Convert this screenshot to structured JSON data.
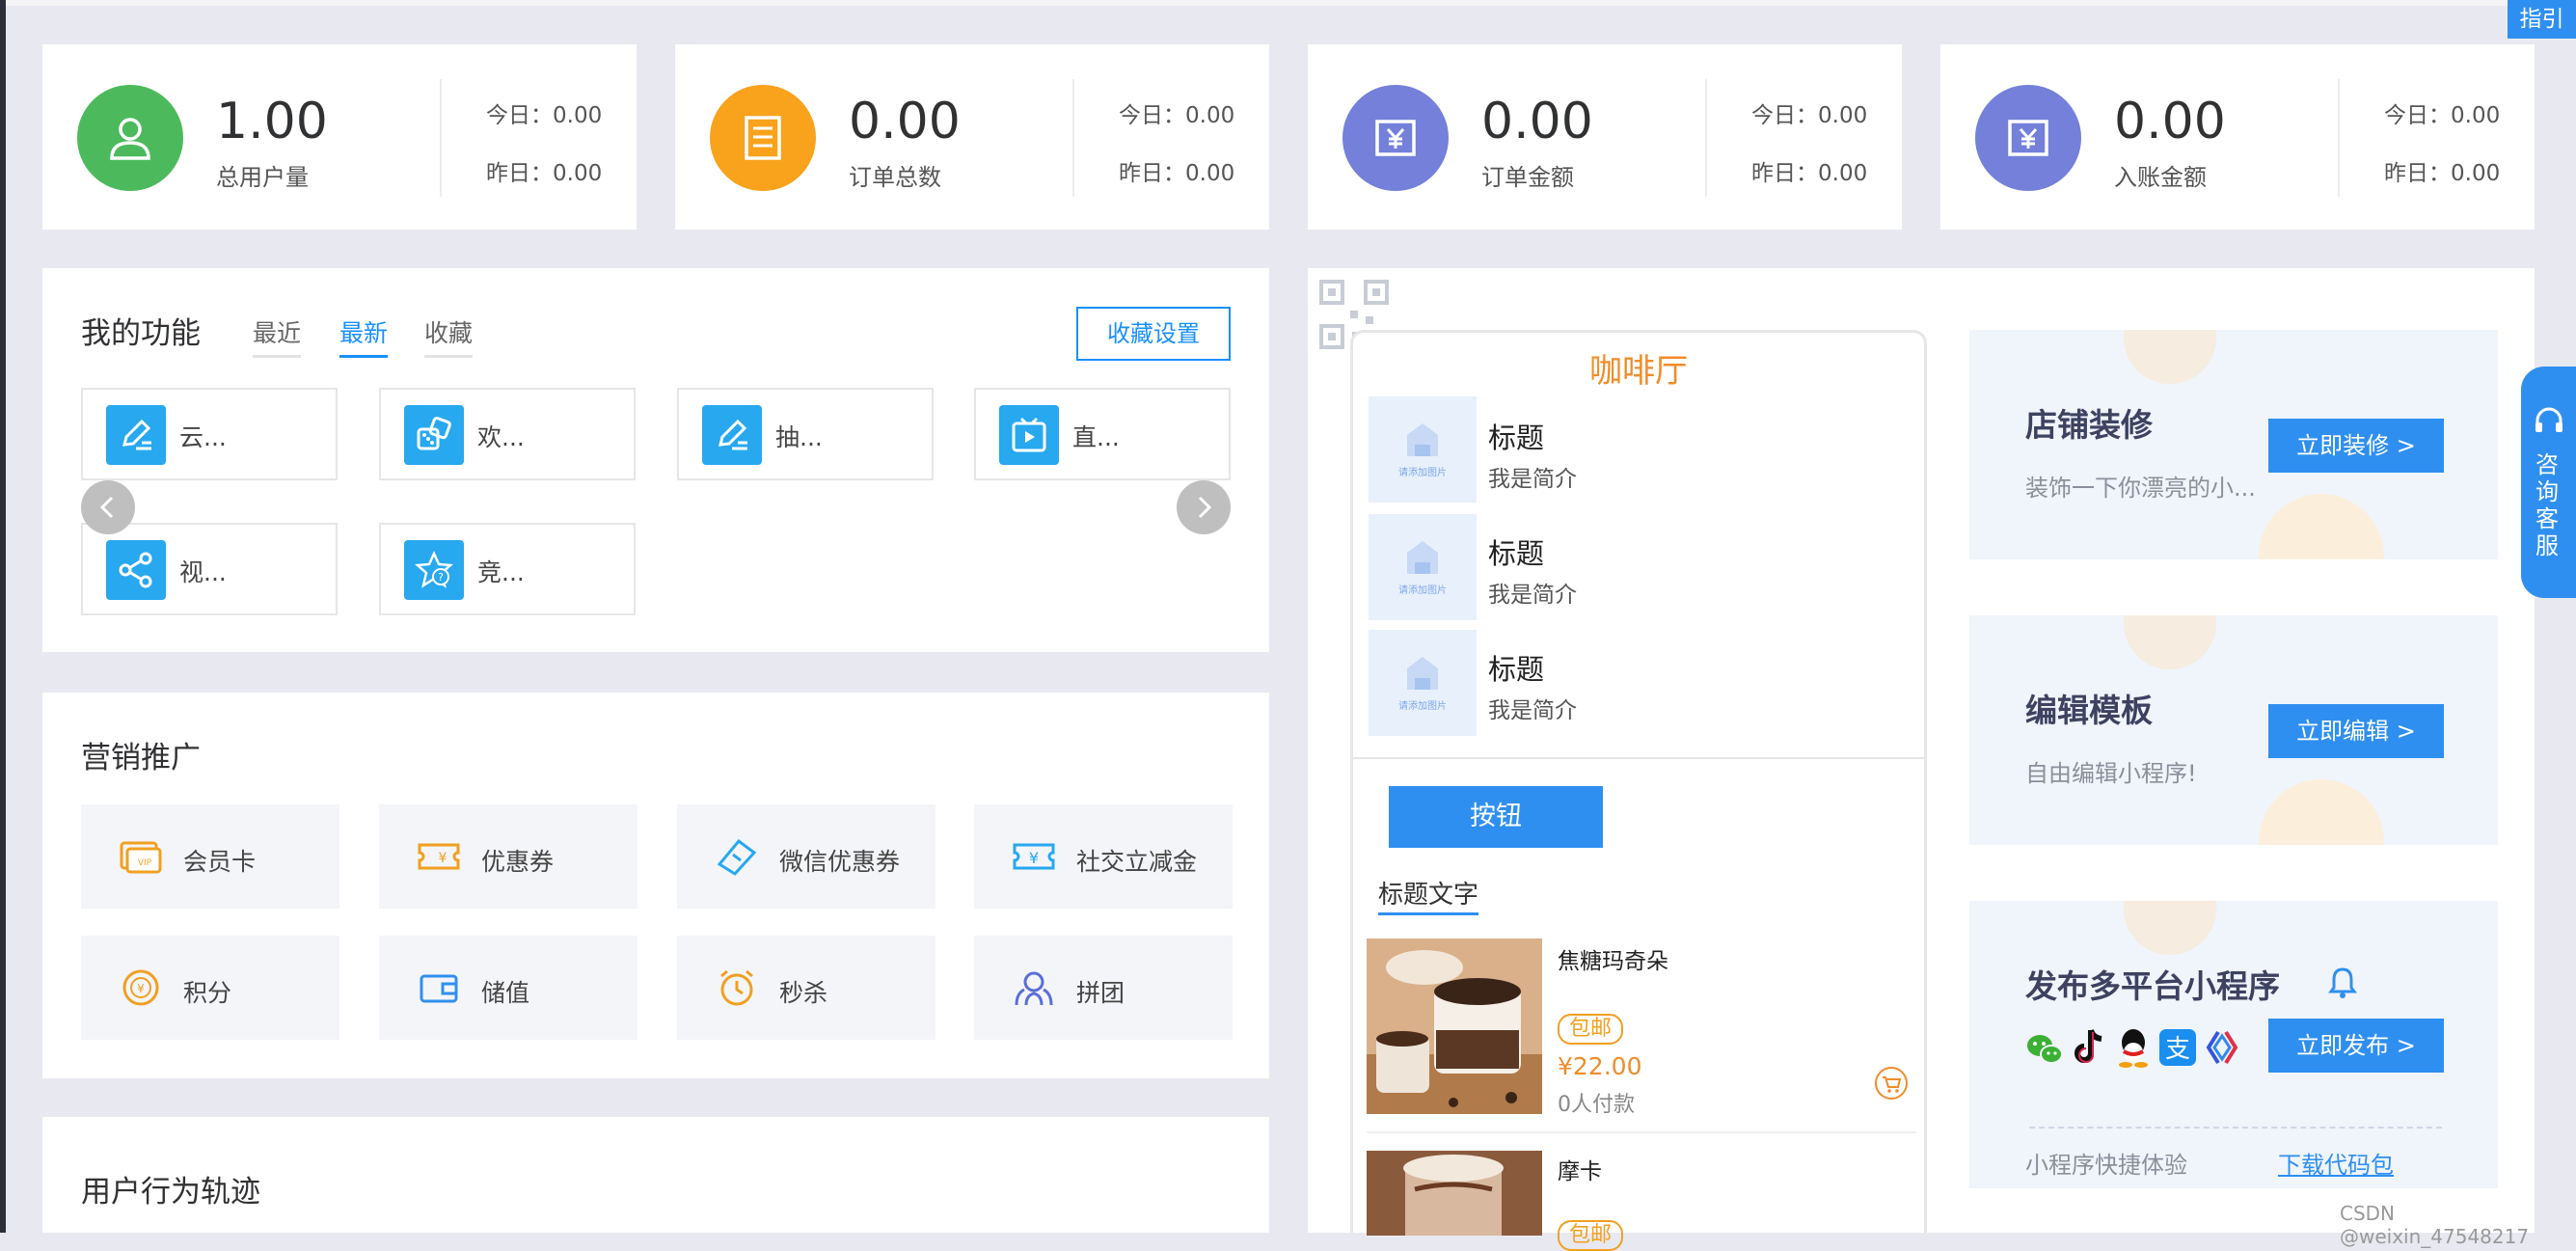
{
  "stats": [
    {
      "value": "1.00",
      "label": "总用户量",
      "today": "今日：0.00",
      "yesterday": "昨日：0.00",
      "icon": "user-icon",
      "color": "#4cba5c"
    },
    {
      "value": "0.00",
      "label": "订单总数",
      "today": "今日：0.00",
      "yesterday": "昨日：0.00",
      "icon": "order-list-icon",
      "color": "#f9a21c"
    },
    {
      "value": "0.00",
      "label": "订单金额",
      "today": "今日：0.00",
      "yesterday": "昨日：0.00",
      "icon": "yen-box-icon",
      "color": "#7480d9"
    },
    {
      "value": "0.00",
      "label": "入账金额",
      "today": "今日：0.00",
      "yesterday": "昨日：0.00",
      "icon": "yen-box-icon",
      "color": "#7480d9"
    }
  ],
  "functions": {
    "title": "我的功能",
    "tabs": [
      "最近",
      "最新",
      "收藏"
    ],
    "active_tab": "最新",
    "settings_button": "收藏设置",
    "items": [
      {
        "label": "云...",
        "icon": "edit-pen-icon"
      },
      {
        "label": "欢...",
        "icon": "dice-icon"
      },
      {
        "label": "抽...",
        "icon": "edit-pen-icon"
      },
      {
        "label": "直...",
        "icon": "live-tv-icon"
      },
      {
        "label": "视...",
        "icon": "share-icon"
      },
      {
        "label": "竞...",
        "icon": "star-question-icon"
      }
    ]
  },
  "marketing": {
    "title": "营销推广",
    "items": [
      {
        "label": "会员卡",
        "icon": "vip-card-icon",
        "color": "#f0a020"
      },
      {
        "label": "优惠券",
        "icon": "coupon-icon",
        "color": "#f0a020"
      },
      {
        "label": "微信优惠券",
        "icon": "ticket-icon",
        "color": "#27a8ef"
      },
      {
        "label": "社交立减金",
        "icon": "yen-ticket-icon",
        "color": "#27a8ef"
      },
      {
        "label": "积分",
        "icon": "points-icon",
        "color": "#f0a020"
      },
      {
        "label": "储值",
        "icon": "wallet-icon",
        "color": "#2f8ff0"
      },
      {
        "label": "秒杀",
        "icon": "alarm-icon",
        "color": "#f0a020"
      },
      {
        "label": "拼团",
        "icon": "group-icon",
        "color": "#5b6fd8"
      }
    ]
  },
  "behavior": {
    "title": "用户行为轨迹"
  },
  "preview": {
    "shop_name": "咖啡厅",
    "list": [
      {
        "title": "标题",
        "desc": "我是简介",
        "img_text": "请添加图片"
      },
      {
        "title": "标题",
        "desc": "我是简介",
        "img_text": "请添加图片"
      },
      {
        "title": "标题",
        "desc": "我是简介",
        "img_text": "请添加图片"
      }
    ],
    "button": "按钮",
    "heading": "标题文字",
    "products": [
      {
        "name": "焦糖玛奇朵",
        "tag": "包邮",
        "price": "¥22.00",
        "paid": "0人付款"
      },
      {
        "name": "摩卡",
        "tag": "包邮"
      }
    ]
  },
  "promos": [
    {
      "title": "店铺装修",
      "sub": "装饰一下你漂亮的小...",
      "button": "立即装修 >"
    },
    {
      "title": "编辑模板",
      "sub": "自由编辑小程序!",
      "button": "立即编辑 >"
    },
    {
      "title": "发布多平台小程序",
      "button": "立即发布 >",
      "footer_text": "小程序快捷体验",
      "footer_link": "下载代码包"
    }
  ],
  "guide": "指引",
  "service": "咨询客服",
  "watermark": "CSDN @weixin_47548217"
}
